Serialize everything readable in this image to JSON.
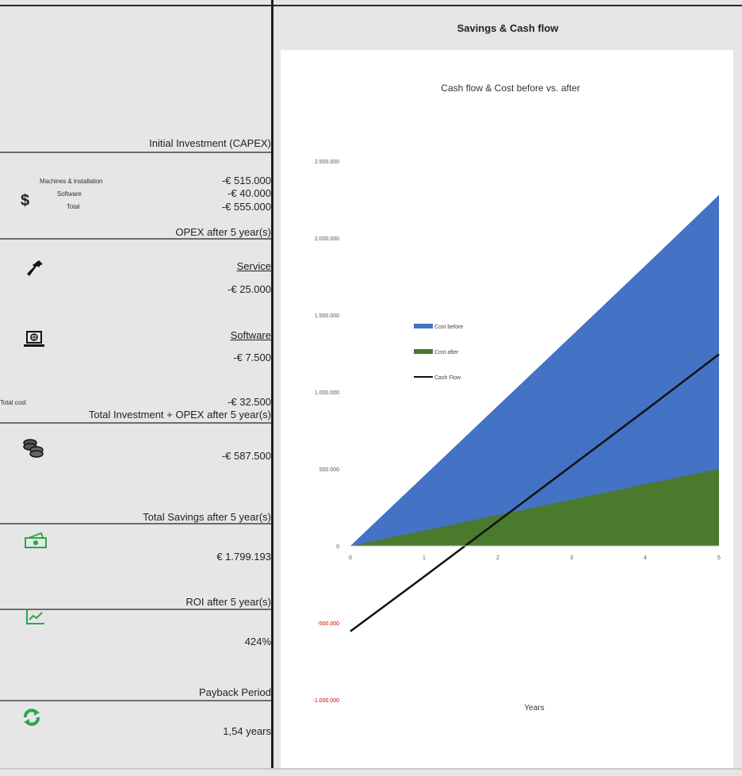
{
  "capex": {
    "title": "Initial Investment (CAPEX)",
    "machines_label": "Machines & installation",
    "machines_value": "-€ 515.000",
    "software_label": "Software",
    "software_value": "-€ 40.000",
    "total_label": "Total",
    "total_value": "-€ 555.000"
  },
  "opex": {
    "title": "OPEX after 5 year(s)",
    "service_label": "Service",
    "service_value": "-€ 25.000",
    "software_label": "Software",
    "software_value": "-€ 7.500",
    "total_cost_label": "Total cost",
    "total_cost_value": "-€ 32.500"
  },
  "total_investment": {
    "title": "Total Investment + OPEX after 5 year(s)",
    "value": "-€ 587.500"
  },
  "savings": {
    "title": "Total Savings after 5 year(s)",
    "value": "€ 1.799.193"
  },
  "roi": {
    "title": "ROI after 5 year(s)",
    "value": "424%"
  },
  "payback": {
    "title": "Payback Period",
    "value": "1,54 years"
  },
  "right_panel": {
    "header": "Savings & Cash flow"
  },
  "icons": {
    "dollar": "dollar-icon",
    "wrench": "wrench-icon",
    "laptop": "laptop-software-icon",
    "coins": "coins-icon",
    "money": "money-icon",
    "chart": "trend-chart-icon",
    "refresh": "refresh-icon",
    "dollar_glyph": "$"
  },
  "colors": {
    "cost_before": "#4472c4",
    "cost_after": "#4a7a2c",
    "cash_flow": "#111111",
    "negative_tick": "#cc0000",
    "green_icon": "#2aa84a"
  },
  "chart_data": {
    "type": "area",
    "title": "Cash flow & Cost before vs. after",
    "xlabel": "Years",
    "x": [
      0,
      1,
      2,
      3,
      4,
      5
    ],
    "xlim": [
      0,
      5
    ],
    "ylim": [
      -1000000,
      2500000
    ],
    "y_ticks": [
      -1000000,
      -500000,
      0,
      500000,
      1000000,
      1500000,
      2000000,
      2500000
    ],
    "y_tick_labels": [
      "-1.000.000",
      "-500.000",
      "0",
      "500.000",
      "1.000.000",
      "1.500.000",
      "2.000.000",
      "2.500.000"
    ],
    "x_tick_labels": [
      "0",
      "1",
      "2",
      "3",
      "4",
      "5"
    ],
    "legend_position": "left",
    "series": [
      {
        "name": "Cost before",
        "kind": "area",
        "values": [
          0,
          455000,
          910000,
          1365000,
          1820000,
          2280000
        ]
      },
      {
        "name": "Cost after",
        "kind": "area",
        "values": [
          0,
          100000,
          200000,
          300000,
          400000,
          500000
        ]
      },
      {
        "name": "Cash Flow",
        "kind": "line",
        "values": [
          -555000,
          -200000,
          160000,
          520000,
          880000,
          1245000
        ]
      }
    ]
  }
}
